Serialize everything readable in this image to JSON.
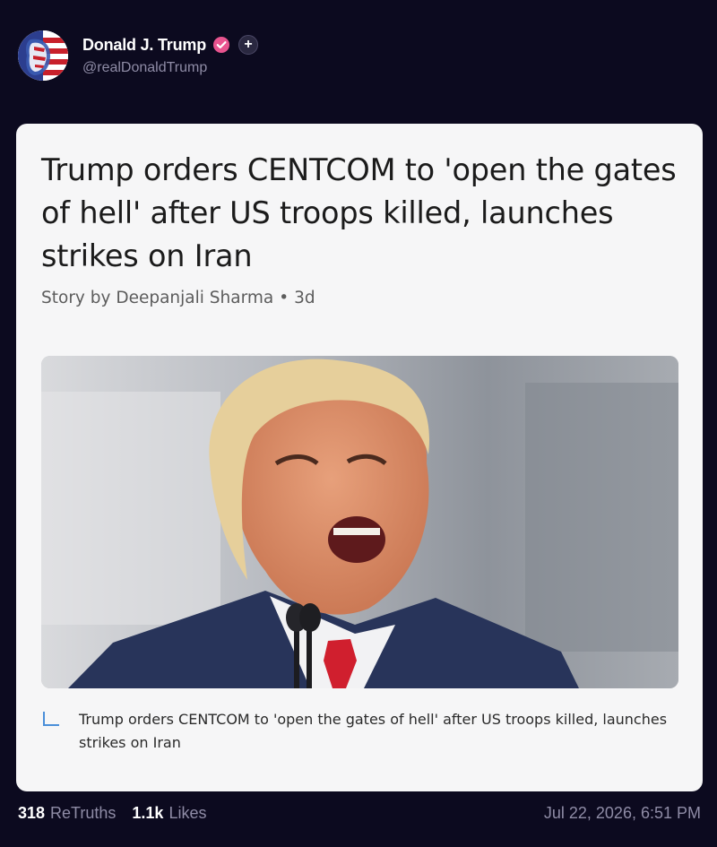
{
  "post": {
    "author": {
      "display_name": "Donald J. Trump",
      "handle": "@realDonaldTrump",
      "verified_icon": "verified-badge-icon",
      "follow_icon": "plus-icon",
      "follow_label": "+"
    },
    "card": {
      "headline": "Trump orders CENTCOM to 'open the gates of hell' after US troops killed, launches strikes on Iran",
      "byline_author": "Story by Deepanjali Sharma",
      "byline_sep": "•",
      "byline_age": "3d",
      "caption": "Trump orders CENTCOM to 'open the gates of hell' after US troops killed, launches strikes on Iran"
    },
    "stats": {
      "retruths_count": "318",
      "retruths_label": "ReTruths",
      "likes_count": "1.1k",
      "likes_label": "Likes"
    },
    "timestamp": "Jul 22, 2026, 6:51 PM"
  },
  "colors": {
    "background": "#0c0a1f",
    "card": "#f6f6f7",
    "verified": "#e8548f",
    "muted_text": "#8f8ca6"
  }
}
